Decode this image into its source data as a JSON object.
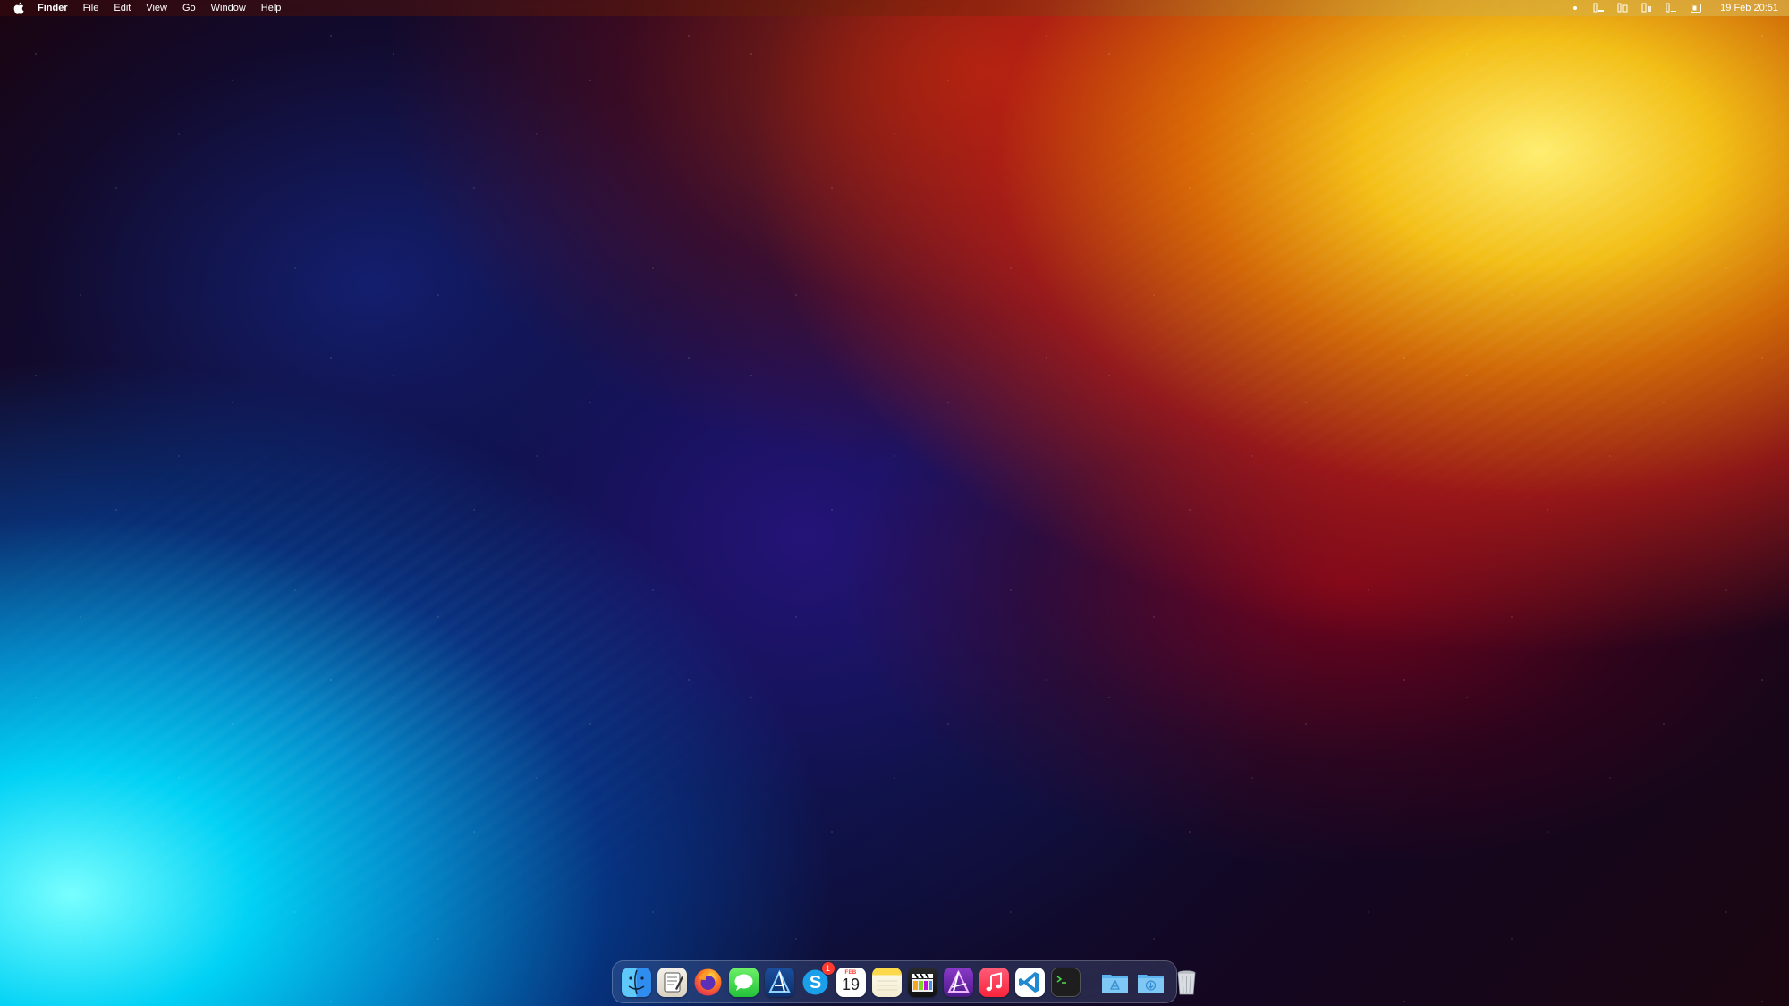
{
  "menubar": {
    "apple_icon": "apple-logo-icon",
    "app_name": "Finder",
    "menus": [
      "File",
      "Edit",
      "View",
      "Go",
      "Window",
      "Help"
    ],
    "status_icons": [
      "status-dot-icon",
      "status-extension-1-icon",
      "status-extension-2-icon",
      "status-extension-3-icon",
      "status-extension-4-icon",
      "control-center-icon"
    ],
    "clock": "19 Feb  20:51"
  },
  "dock": {
    "apps": [
      {
        "name": "Finder",
        "icon": "finder-icon"
      },
      {
        "name": "Script Editor",
        "icon": "script-editor-icon"
      },
      {
        "name": "Firefox",
        "icon": "firefox-icon"
      },
      {
        "name": "Messages",
        "icon": "messages-icon"
      },
      {
        "name": "Affinity Designer",
        "icon": "affinity-designer-icon"
      },
      {
        "name": "Skype",
        "icon": "skype-icon",
        "badge": "1"
      },
      {
        "name": "Calendar",
        "icon": "calendar-icon",
        "month": "FEB",
        "day": "19"
      },
      {
        "name": "Notes",
        "icon": "notes-icon"
      },
      {
        "name": "Final Cut Pro",
        "icon": "final-cut-pro-icon"
      },
      {
        "name": "Affinity Photo",
        "icon": "affinity-photo-icon"
      },
      {
        "name": "Music",
        "icon": "music-icon"
      },
      {
        "name": "Visual Studio Code",
        "icon": "vscode-icon"
      },
      {
        "name": "Terminal",
        "icon": "terminal-icon"
      }
    ],
    "folders": [
      {
        "name": "Applications",
        "icon": "applications-folder-icon"
      },
      {
        "name": "Downloads",
        "icon": "downloads-folder-icon"
      }
    ],
    "trash": {
      "name": "Trash",
      "icon": "trash-icon"
    }
  },
  "colors": {
    "badge": "#ff3b30",
    "wallpaper_warm": "#ffd000",
    "wallpaper_cool": "#00d8ff"
  }
}
